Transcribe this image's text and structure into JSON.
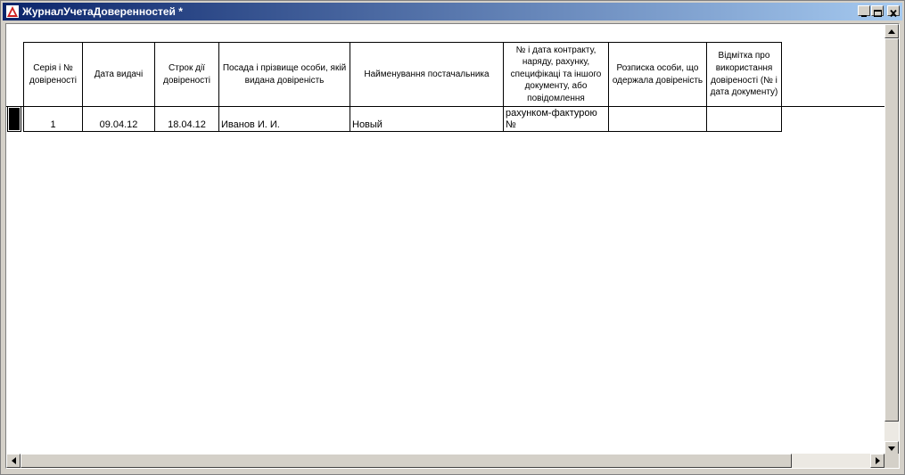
{
  "window": {
    "title": "ЖурналУчетаДоверенностей  *"
  },
  "table": {
    "headers": [
      "Серія і № довіреності",
      "Дата видачі",
      "Строк дії довіреності",
      "Посада і прізвище особи, якій видана довіреність",
      "Найменування постачальника",
      "№ і дата контракту, наряду, рахунку, специфікаці та іншого документу, або повідомлення",
      "Розписка особи, що одержала довіреність",
      "Відмітка про використання довіреності (№ і дата документу)"
    ],
    "rows": [
      [
        "1",
        "09.04.12",
        "18.04.12",
        "Иванов  И. И.",
        "Новый",
        "рахунком-фактурою №",
        "",
        ""
      ]
    ]
  }
}
